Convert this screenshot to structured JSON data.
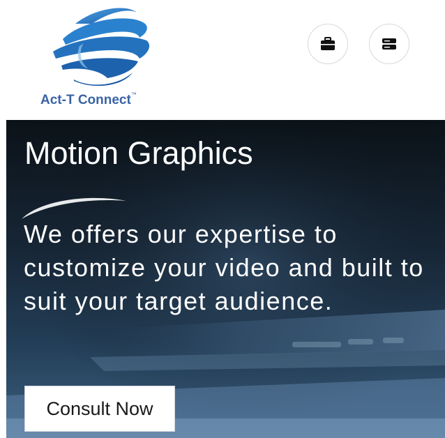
{
  "brand": {
    "name": "Act-T Connect",
    "trademark": "™",
    "logo_icon": "globe-swirl-logo",
    "colors": {
      "primary": "#2a7cc7",
      "dark": "#1f5fa8",
      "text": "#3a63a5"
    }
  },
  "header": {
    "buttons": [
      {
        "name": "briefcase-button",
        "icon": "briefcase-icon"
      },
      {
        "name": "menu-button",
        "icon": "menu-icon"
      }
    ]
  },
  "hero": {
    "title": "Motion Graphics",
    "description": "We offers our expertise to customize your video and built to suit your target audience.",
    "cta_label": "Consult Now"
  }
}
